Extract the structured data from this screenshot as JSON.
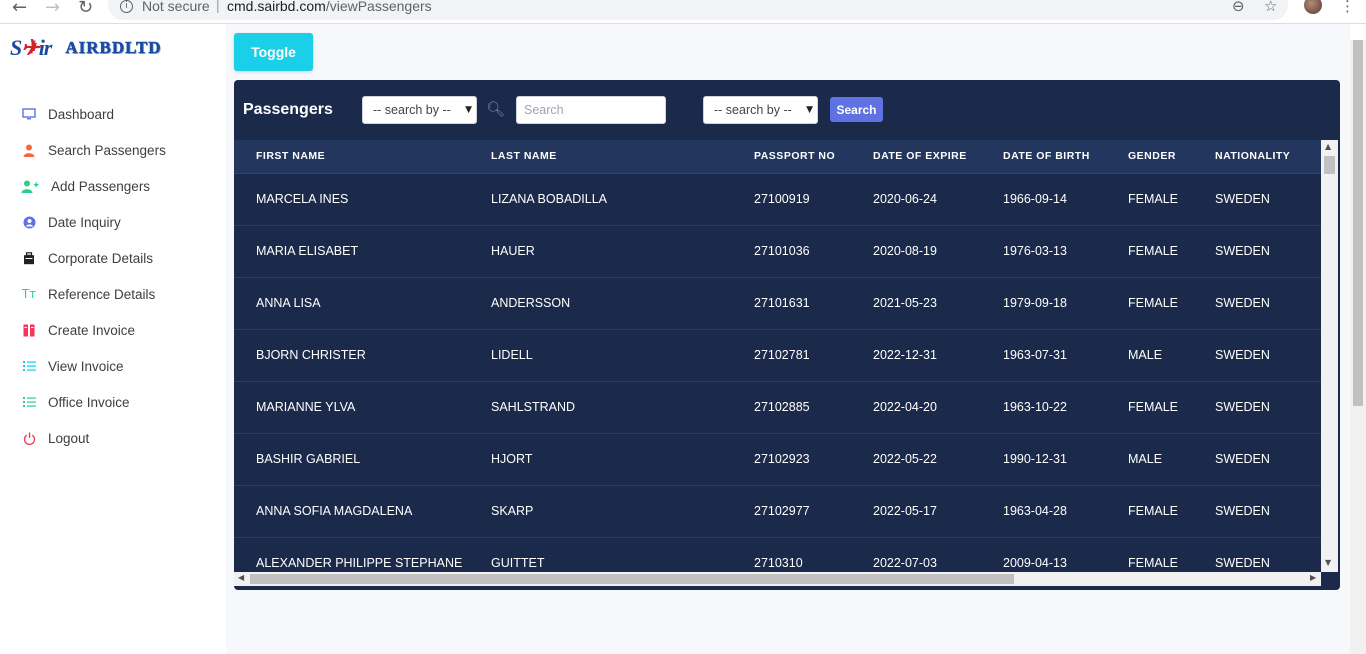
{
  "browser": {
    "back_icon": "←",
    "forward_icon": "→",
    "reload_icon": "↻",
    "security_label": "Not secure",
    "url_host": "cmd.sairbd.com",
    "url_path": "/viewPassengers",
    "zoom_icon": "⊖",
    "star_icon": "☆",
    "menu_icon": "⋮"
  },
  "brand": {
    "logo_part1": "S",
    "logo_part2": "ir",
    "logo_text": "AIRBDLTD"
  },
  "header": {
    "toggle_label": "Toggle"
  },
  "sidebar": {
    "items": [
      {
        "label": "Dashboard",
        "icon": "monitor-icon",
        "color": "#5e72e4"
      },
      {
        "label": "Search Passengers",
        "icon": "user-icon",
        "color": "#f5673a"
      },
      {
        "label": "Add Passengers",
        "icon": "user-plus-icon",
        "color": "#2dce89"
      },
      {
        "label": "Date Inquiry",
        "icon": "user-circle-icon",
        "color": "#5e72e4"
      },
      {
        "label": "Corporate Details",
        "icon": "briefcase-icon",
        "color": "#222222"
      },
      {
        "label": "Reference Details",
        "icon": "text-icon",
        "color": "#2dce89"
      },
      {
        "label": "Create Invoice",
        "icon": "invoice-icon",
        "color": "#f5365c"
      },
      {
        "label": "View Invoice",
        "icon": "list-icon",
        "color": "#11cdef"
      },
      {
        "label": "Office Invoice",
        "icon": "list-icon",
        "color": "#2dce89"
      },
      {
        "label": "Logout",
        "icon": "power-icon",
        "color": "#f5365c"
      }
    ]
  },
  "passengers": {
    "title": "Passengers",
    "search_by_1": "-- search by --",
    "search_placeholder": "Search",
    "search_by_2": "-- search by --",
    "search_button": "Search",
    "columns": [
      "FIRST NAME",
      "LAST NAME",
      "PASSPORT NO",
      "DATE OF EXPIRE",
      "DATE OF BIRTH",
      "GENDER",
      "NATIONALITY"
    ],
    "rows": [
      [
        "MARCELA INES",
        "LIZANA BOBADILLA",
        "27100919",
        "2020-06-24",
        "1966-09-14",
        "FEMALE",
        "SWEDEN"
      ],
      [
        "MARIA ELISABET",
        "HAUER",
        "27101036",
        "2020-08-19",
        "1976-03-13",
        "FEMALE",
        "SWEDEN"
      ],
      [
        "ANNA LISA",
        "ANDERSSON",
        "27101631",
        "2021-05-23",
        "1979-09-18",
        "FEMALE",
        "SWEDEN"
      ],
      [
        "BJORN CHRISTER",
        "LIDELL",
        "27102781",
        "2022-12-31",
        "1963-07-31",
        "MALE",
        "SWEDEN"
      ],
      [
        "MARIANNE YLVA",
        "SAHLSTRAND",
        "27102885",
        "2022-04-20",
        "1963-10-22",
        "FEMALE",
        "SWEDEN"
      ],
      [
        "BASHIR GABRIEL",
        "HJORT",
        "27102923",
        "2022-05-22",
        "1990-12-31",
        "MALE",
        "SWEDEN"
      ],
      [
        "ANNA SOFIA MAGDALENA",
        "SKARP",
        "27102977",
        "2022-05-17",
        "1963-04-28",
        "FEMALE",
        "SWEDEN"
      ],
      [
        "ALEXANDER PHILIPPE STEPHANE",
        "GUITTET",
        "2710310",
        "2022-07-03",
        "2009-04-13",
        "FEMALE",
        "SWEDEN"
      ]
    ]
  },
  "colors": {
    "panel_bg": "#1b2a4a",
    "header_row_bg": "#22365e",
    "toggle_bg": "#1ccfe8",
    "search_button_bg": "#5e72e4"
  }
}
